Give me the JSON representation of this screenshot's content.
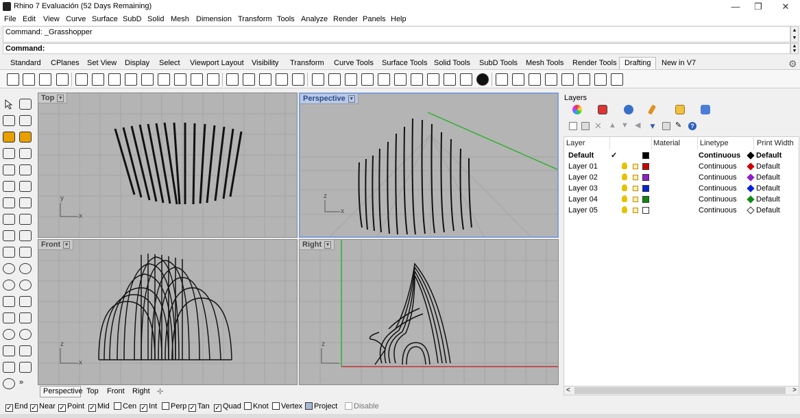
{
  "window": {
    "title": "Rhino 7 Evaluación (52 Days Remaining)",
    "minimize": "—",
    "maximize": "❐",
    "close": "✕"
  },
  "menu": [
    "File",
    "Edit",
    "View",
    "Curve",
    "Surface",
    "SubD",
    "Solid",
    "Mesh",
    "Dimension",
    "Transform",
    "Tools",
    "Analyze",
    "Render",
    "Panels",
    "Help"
  ],
  "command": {
    "history": "Command: _Grasshopper",
    "prompt": "Command:"
  },
  "toolbar_tabs": [
    "Standard",
    "CPlanes",
    "Set View",
    "Display",
    "Select",
    "Viewport Layout",
    "Visibility",
    "Transform",
    "Curve Tools",
    "Surface Tools",
    "Solid Tools",
    "SubD Tools",
    "Mesh Tools",
    "Render Tools",
    "Drafting",
    "New in V7"
  ],
  "active_toolbar_tab": "Drafting",
  "viewports": {
    "top": {
      "label": "Top"
    },
    "perspective": {
      "label": "Perspective"
    },
    "front": {
      "label": "Front"
    },
    "right": {
      "label": "Right"
    }
  },
  "axes": {
    "x": "x",
    "y": "y",
    "z": "z"
  },
  "viewport_tabs": [
    "Perspective",
    "Top",
    "Front",
    "Right"
  ],
  "viewport_tab_add": "✢",
  "layers": {
    "title": "Layers",
    "columns": [
      "Layer",
      "Material",
      "Linetype",
      "Print Width"
    ],
    "rows": [
      {
        "name": "Default",
        "linetype": "Continuous",
        "print_width": "Default",
        "color": "#000000",
        "current": true,
        "check": "✓"
      },
      {
        "name": "Layer 01",
        "linetype": "Continuous",
        "print_width": "Default",
        "color": "#cc0000"
      },
      {
        "name": "Layer 02",
        "linetype": "Continuous",
        "print_width": "Default",
        "color": "#8e1fc8"
      },
      {
        "name": "Layer 03",
        "linetype": "Continuous",
        "print_width": "Default",
        "color": "#0022dd"
      },
      {
        "name": "Layer 04",
        "linetype": "Continuous",
        "print_width": "Default",
        "color": "#0f8a0f"
      },
      {
        "name": "Layer 05",
        "linetype": "Continuous",
        "print_width": "Default",
        "color": "#ffffff"
      }
    ],
    "scroll_left": "<",
    "scroll_right": ">"
  },
  "osnaps": [
    {
      "label": "End",
      "checked": true
    },
    {
      "label": "Near",
      "checked": true
    },
    {
      "label": "Point",
      "checked": true
    },
    {
      "label": "Mid",
      "checked": true
    },
    {
      "label": "Cen",
      "checked": false
    },
    {
      "label": "Int",
      "checked": true
    },
    {
      "label": "Perp",
      "checked": false
    },
    {
      "label": "Tan",
      "checked": true
    },
    {
      "label": "Quad",
      "checked": true
    },
    {
      "label": "Knot",
      "checked": false
    },
    {
      "label": "Vertex",
      "checked": false
    },
    {
      "label": "Project",
      "checked": false,
      "style": "filled"
    },
    {
      "label": "Disable",
      "checked": false,
      "disabled": true
    }
  ],
  "colors": {
    "viewport_bg": "#b4b4b4",
    "grid": "#a4a4a4",
    "x_axis": "#c43030",
    "y_axis": "#30b030",
    "active_label": "#2a4a8a"
  }
}
